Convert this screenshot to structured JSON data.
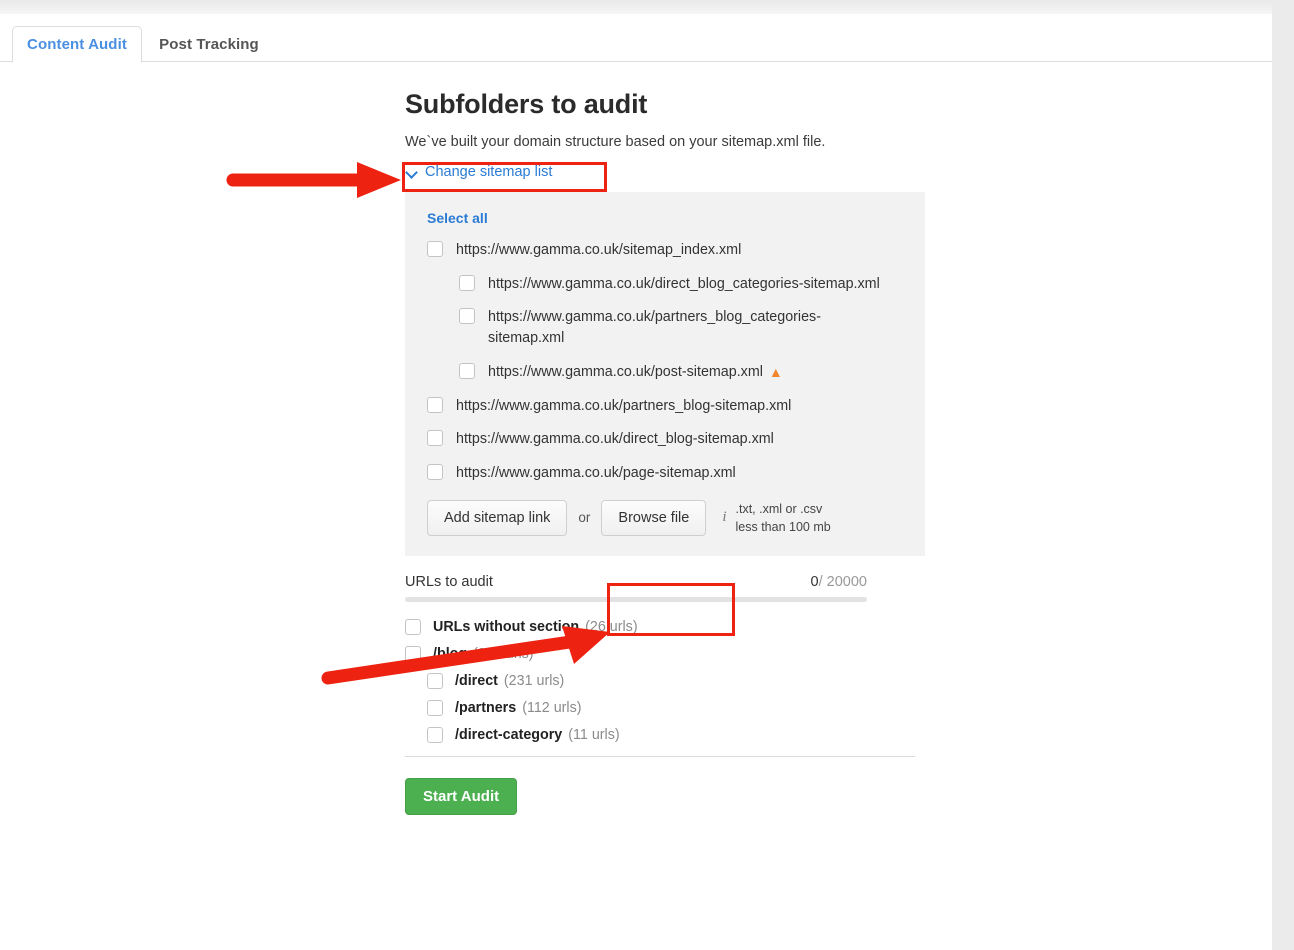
{
  "tabs": [
    {
      "label": "Content Audit",
      "active": true
    },
    {
      "label": "Post Tracking",
      "active": false
    }
  ],
  "main": {
    "title": "Subfolders to audit",
    "subtitle": "We`ve built your domain structure based on your sitemap.xml file.",
    "change_sitemap_label": "Change sitemap list",
    "chevron_icon": "chevron-down-icon"
  },
  "sitemap_panel": {
    "select_all_label": "Select all",
    "items": [
      {
        "label": "https://www.gamma.co.uk/sitemap_index.xml",
        "level": 0,
        "checked": false,
        "warning": false
      },
      {
        "label": "https://www.gamma.co.uk/direct_blog_categories-sitemap.xml",
        "level": 1,
        "checked": false,
        "warning": false
      },
      {
        "label": "https://www.gamma.co.uk/partners_blog_categories-sitemap.xml",
        "level": 1,
        "checked": false,
        "warning": false
      },
      {
        "label": "https://www.gamma.co.uk/post-sitemap.xml",
        "level": 1,
        "checked": false,
        "warning": true
      },
      {
        "label": "https://www.gamma.co.uk/partners_blog-sitemap.xml",
        "level": 0,
        "checked": false,
        "warning": false
      },
      {
        "label": "https://www.gamma.co.uk/direct_blog-sitemap.xml",
        "level": 0,
        "checked": false,
        "warning": false
      },
      {
        "label": "https://www.gamma.co.uk/page-sitemap.xml",
        "level": 0,
        "checked": false,
        "warning": false
      }
    ],
    "warning_icon": "warning-triangle-icon",
    "warning_color": "#f0872c",
    "add_sitemap_label": "Add sitemap link",
    "or_label": "or",
    "browse_file_label": "Browse file",
    "info_icon": "info-icon",
    "info_line1": ".txt, .xml or .csv",
    "info_line2": "less than 100 mb"
  },
  "urls_to_audit": {
    "label": "URLs to audit",
    "current": "0",
    "separator": "/ ",
    "limit": "20000",
    "progress_percent": 0
  },
  "folders": [
    {
      "name": "URLs without section",
      "count": "(26 urls)",
      "level": 0,
      "checked": false
    },
    {
      "name": "/blog",
      "count": "(364 urls)",
      "level": 0,
      "checked": false
    },
    {
      "name": "/direct",
      "count": "(231 urls)",
      "level": 1,
      "checked": false
    },
    {
      "name": "/partners",
      "count": "(112 urls)",
      "level": 1,
      "checked": false
    },
    {
      "name": "/direct-category",
      "count": "(11 urls)",
      "level": 1,
      "checked": false
    }
  ],
  "actions": {
    "start_audit_label": "Start Audit",
    "start_audit_color": "#4caf50"
  },
  "annotations": {
    "highlight_color": "#ee2211",
    "boxes": [
      {
        "name": "change-sitemap-highlight"
      },
      {
        "name": "browse-file-highlight"
      }
    ],
    "arrows": [
      {
        "name": "arrow-to-change-sitemap"
      },
      {
        "name": "arrow-to-browse-file"
      }
    ]
  }
}
